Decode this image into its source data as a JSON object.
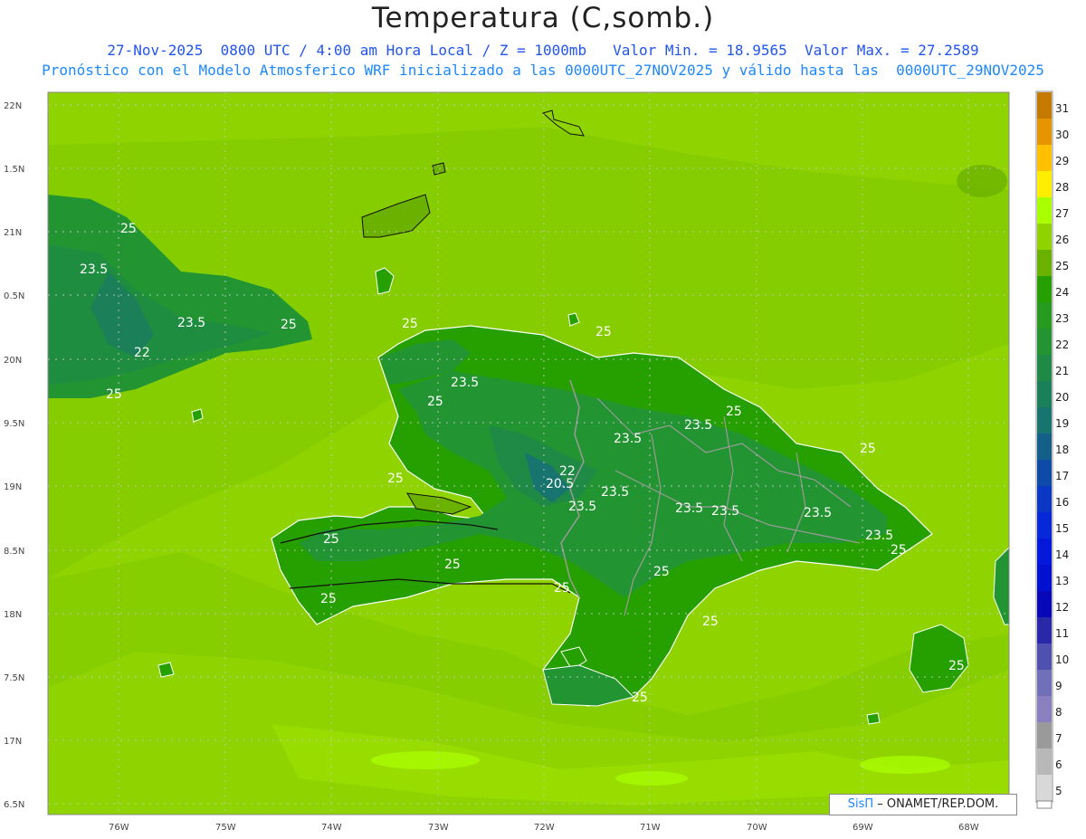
{
  "header": {
    "title": "Temperatura (C,somb.)",
    "line1": "27-Nov-2025  0800 UTC / 4:00 am Hora Local / Z = 1000mb   Valor Min. = 18.9565  Valor Max. = 27.2589",
    "line2": "Pronóstico con el Modelo Atmosferico WRF inicializado a las 0000UTC_27NOV2025 y válido hasta las  0000UTC_29NOV2025"
  },
  "axes": {
    "lat_labels": [
      "22N",
      "1.5N",
      "21N",
      "0.5N",
      "20N",
      "9.5N",
      "19N",
      "8.5N",
      "18N",
      "7.5N",
      "17N",
      "6.5N"
    ],
    "lon_labels": [
      "76W",
      "75W",
      "74W",
      "73W",
      "72W",
      "71W",
      "70W",
      "69W",
      "68W"
    ]
  },
  "legend": {
    "levels": [
      "31",
      "30",
      "29",
      "28",
      "27",
      "26",
      "25",
      "24",
      "23",
      "22",
      "21",
      "20",
      "19",
      "18",
      "17",
      "16",
      "15",
      "14",
      "13",
      "12",
      "11",
      "10",
      "9",
      "8",
      "7",
      "6",
      "5"
    ],
    "colors": [
      "#c47a00",
      "#e69500",
      "#ffc000",
      "#ffee00",
      "#aaff00",
      "#8fd400",
      "#6ab100",
      "#25a000",
      "#259b20",
      "#229532",
      "#1e8a46",
      "#1b7f5a",
      "#17746e",
      "#135f8a",
      "#0e4aa8",
      "#0a38c4",
      "#0628d8",
      "#0418dc",
      "#0210d0",
      "#0808b8",
      "#2828a8",
      "#5050b0",
      "#7070b8",
      "#8a80c0",
      "#9a9a9a",
      "#b8b8b8",
      "#d8d8d8"
    ]
  },
  "contour_labels": [
    "25",
    "23.5",
    "23.5",
    "22",
    "25",
    "25",
    "25",
    "23.5",
    "25",
    "23.5",
    "23.5",
    "25",
    "22",
    "20.5",
    "23.5",
    "23.5",
    "23.5",
    "23.5",
    "23.5",
    "25",
    "25",
    "25",
    "25",
    "25",
    "25",
    "25",
    "25",
    "25",
    "25",
    "25",
    "23.5",
    "25"
  ],
  "credit": {
    "sis": "SisΠ",
    "rest": " – ONAMET/REP.DOM."
  }
}
